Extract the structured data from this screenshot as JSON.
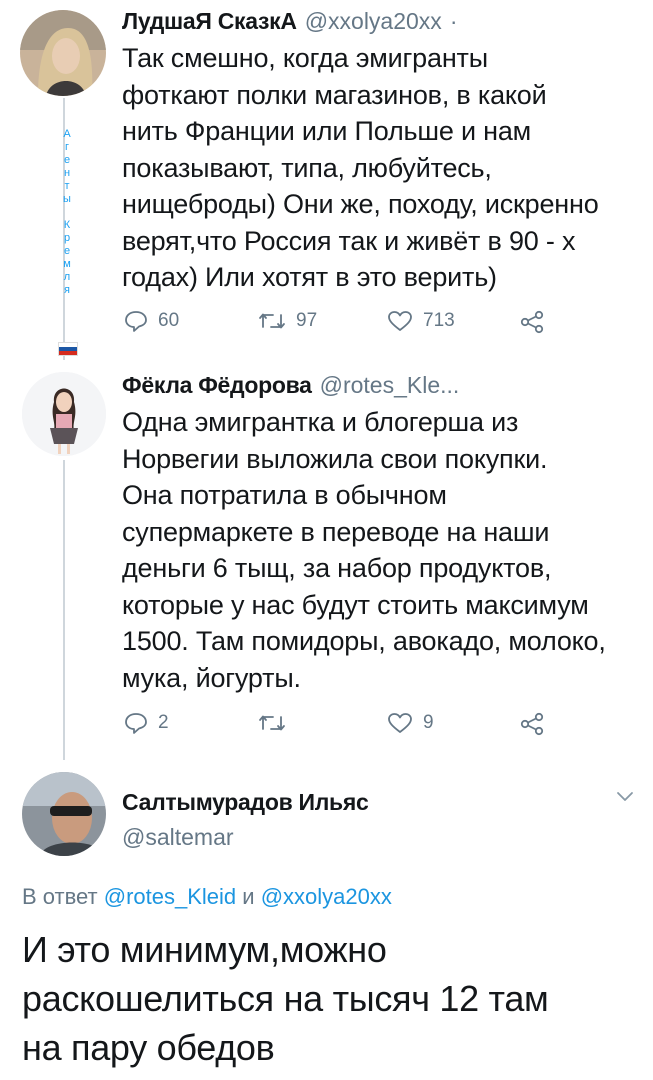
{
  "tweet1": {
    "name": "ЛудшаЯ СказкА",
    "handle": "@xxolya20xx",
    "separator": "·",
    "lines": [
      "Так смешно, когда  эмигранты",
      "фоткают полки магазинов, в какой",
      "нить Франции или Польше и нам",
      "показывают, типа, любуйтесь,",
      "нищеброды) Они же, походу, искренно",
      "верят,что Россия так и живёт в 90 - х",
      "годах) Или хотят в это верить)"
    ],
    "side_letters": [
      "А",
      "г",
      "е",
      "н",
      "т",
      "ы",
      "",
      "К",
      "р",
      "е",
      "м",
      "л",
      "я"
    ],
    "flag_colors": [
      "#ffffff",
      "#1c57a5",
      "#d52b1e"
    ],
    "reply_count": "60",
    "retweet_count": "97",
    "like_count": "713"
  },
  "tweet2": {
    "name": "Фёкла Фёдорова",
    "handle": "@rotes_Kle...",
    "lines": [
      "Одна эмигрантка и блогерша из",
      "Норвегии выложила свои покупки.",
      "Она потратила в обычном",
      "супермаркете в переводе на наши",
      "деньги 6 тыщ, за набор продуктов,",
      "которые у нас будут стоить максимум",
      "1500. Там помидоры, авокадо, молоко,",
      "мука, йогурты."
    ],
    "reply_count": "2",
    "retweet_count": "",
    "like_count": "9"
  },
  "tweet3": {
    "name": "Салтымурадов Ильяс",
    "handle": "@saltemar",
    "reply_prefix": "В ответ",
    "reply_user1": "@rotes_Kleid",
    "reply_and": "и",
    "reply_user2": "@xxolya20xx",
    "lines": [
      "И это минимум,можно",
      "раскошелиться на тысяч 12 там",
      "на пару обедов"
    ]
  },
  "colors": {
    "text": "#14171a",
    "secondary": "#657786",
    "link": "#1b95e0",
    "thread_line": "#cfd6dc"
  },
  "icons": [
    "reply-icon",
    "retweet-icon",
    "like-icon",
    "share-icon",
    "chevron-down-icon"
  ]
}
